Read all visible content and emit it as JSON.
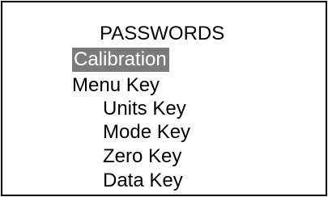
{
  "screen": {
    "title": "PASSWORDS",
    "items": [
      {
        "label": "Calibration",
        "selected": true
      },
      {
        "label": "Menu Key",
        "selected": false
      }
    ],
    "sub_items": [
      {
        "label": "Units Key"
      },
      {
        "label": "Mode Key"
      },
      {
        "label": "Zero Key"
      },
      {
        "label": "Data Key"
      }
    ]
  },
  "colors": {
    "background": "#ffffff",
    "text": "#000000",
    "selection_bg": "#7b7b7b",
    "selection_text": "#ffffff",
    "border": "#000000"
  }
}
